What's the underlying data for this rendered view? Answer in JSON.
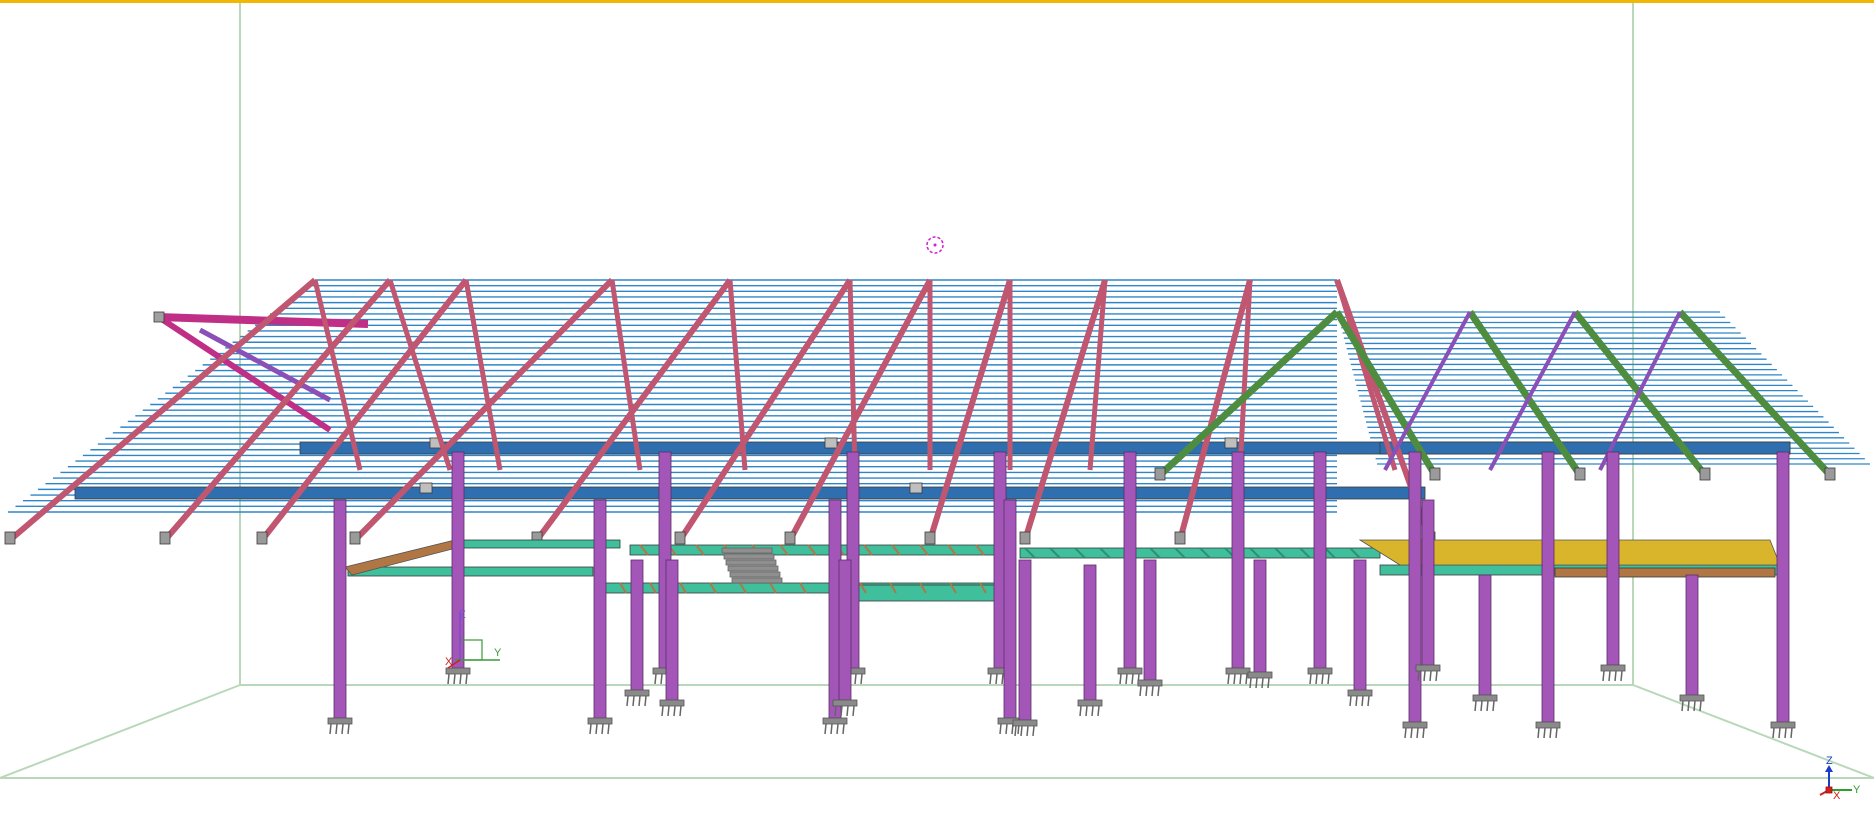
{
  "viewport": {
    "background": "#ffffff",
    "border_accent": "#f2b705",
    "bounding_box_color": "#b9d8b9"
  },
  "colors": {
    "purlin": "#2e86c8",
    "rafter_pink": "#c0566f",
    "rafter_green": "#4e8d3f",
    "brace_pink": "#c02f86",
    "brace_purple": "#8b4fb8",
    "beam_blue": "#2f6fb0",
    "column": "#a456b8",
    "floor_teal": "#3fbf9c",
    "floor_yellow": "#d8b52a",
    "floor_brown": "#b07745",
    "stair_grey": "#8f8f8f",
    "footing_grey": "#8a8a8a",
    "rotation_marker": "#d020d0"
  },
  "icons": {
    "rotation_center": "rotation-center-icon",
    "model_origin_axes": "model-origin-axes-icon",
    "view_triad": "view-triad-icon"
  },
  "local_axes": {
    "x": "X",
    "y": "Y",
    "z": "Z"
  },
  "view_triad": {
    "x": "X",
    "y": "Y",
    "z": "Z"
  }
}
